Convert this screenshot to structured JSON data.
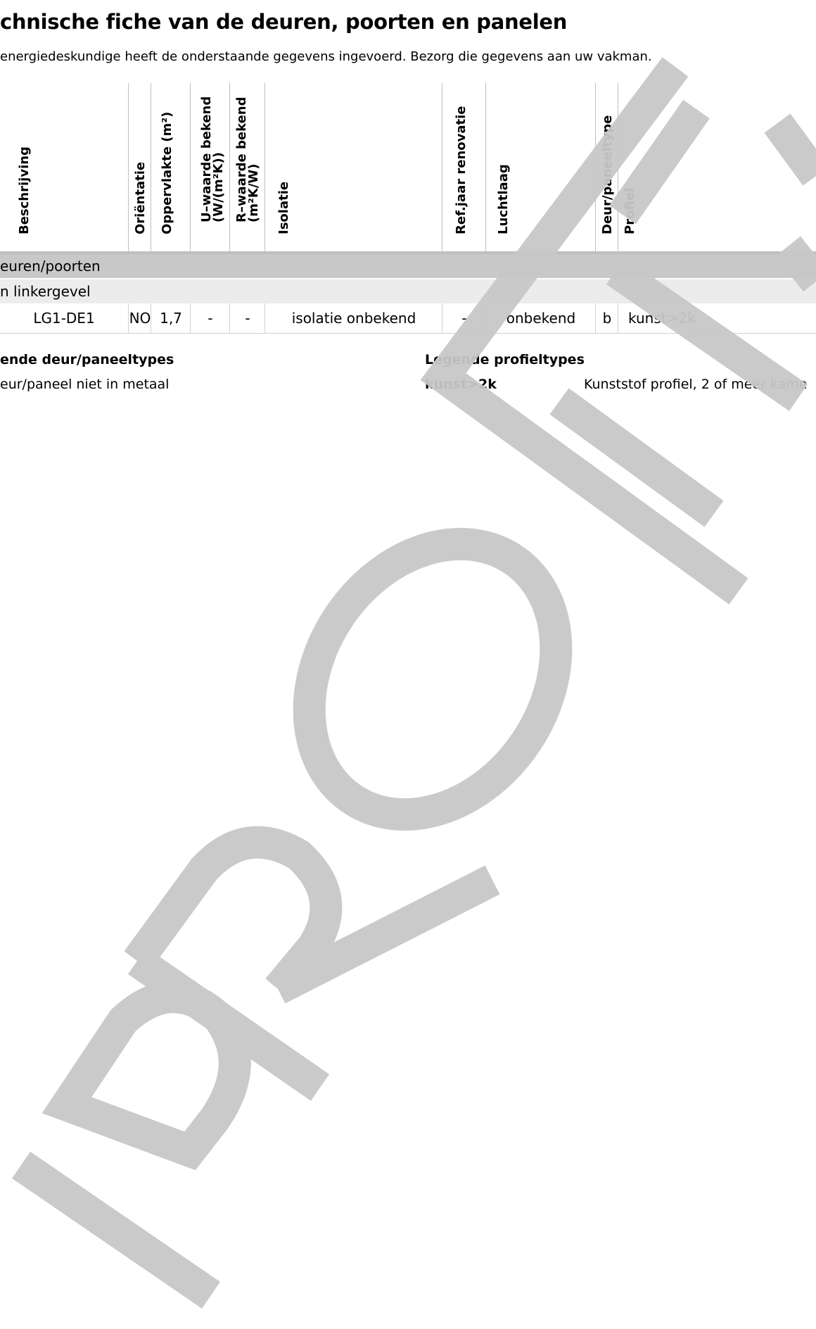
{
  "title": "chnische fiche van de deuren, poorten en panelen",
  "intro": "energiedeskundige heeft de onderstaande gegevens ingevoerd. Bezorg die gegevens aan uw vakman.",
  "table": {
    "headers": {
      "beschrijving": "Beschrijving",
      "orientatie": "Oriëntatie",
      "oppervlakte": "Oppervlakte (m²)",
      "u_line1": "U–waarde bekend",
      "u_line2": "(W/(m²K))",
      "r_line1": "R–waarde bekend",
      "r_line2": "(m²K/W)",
      "isolatie": "Isolatie",
      "refjaar": "Ref.jaar renovatie",
      "luchtlaag": "Luchtlaag",
      "deurtype": "Deur/paneeltype",
      "profiel": "Profiel"
    },
    "group": "euren/poorten",
    "subgroup": "n linkergevel",
    "row": {
      "beschrijving": "LG1-DE1",
      "orientatie": "NO",
      "oppervlakte": "1,7",
      "u_waarde": "-",
      "r_waarde": "-",
      "isolatie": "isolatie onbekend",
      "refjaar": "-",
      "luchtlaag": "onbekend",
      "deurtype": "b",
      "profiel": "kunst>2k"
    }
  },
  "legend_doors": {
    "heading": "ende deur/paneeltypes",
    "text": "eur/paneel niet in metaal"
  },
  "legend_profiles": {
    "heading": "Legende profieltypes",
    "code": "kunst>2k",
    "text": "Kunststof profiel, 2 of meer kame"
  },
  "watermark": {
    "text": "PROEF",
    "color": "#c8c8c8"
  }
}
